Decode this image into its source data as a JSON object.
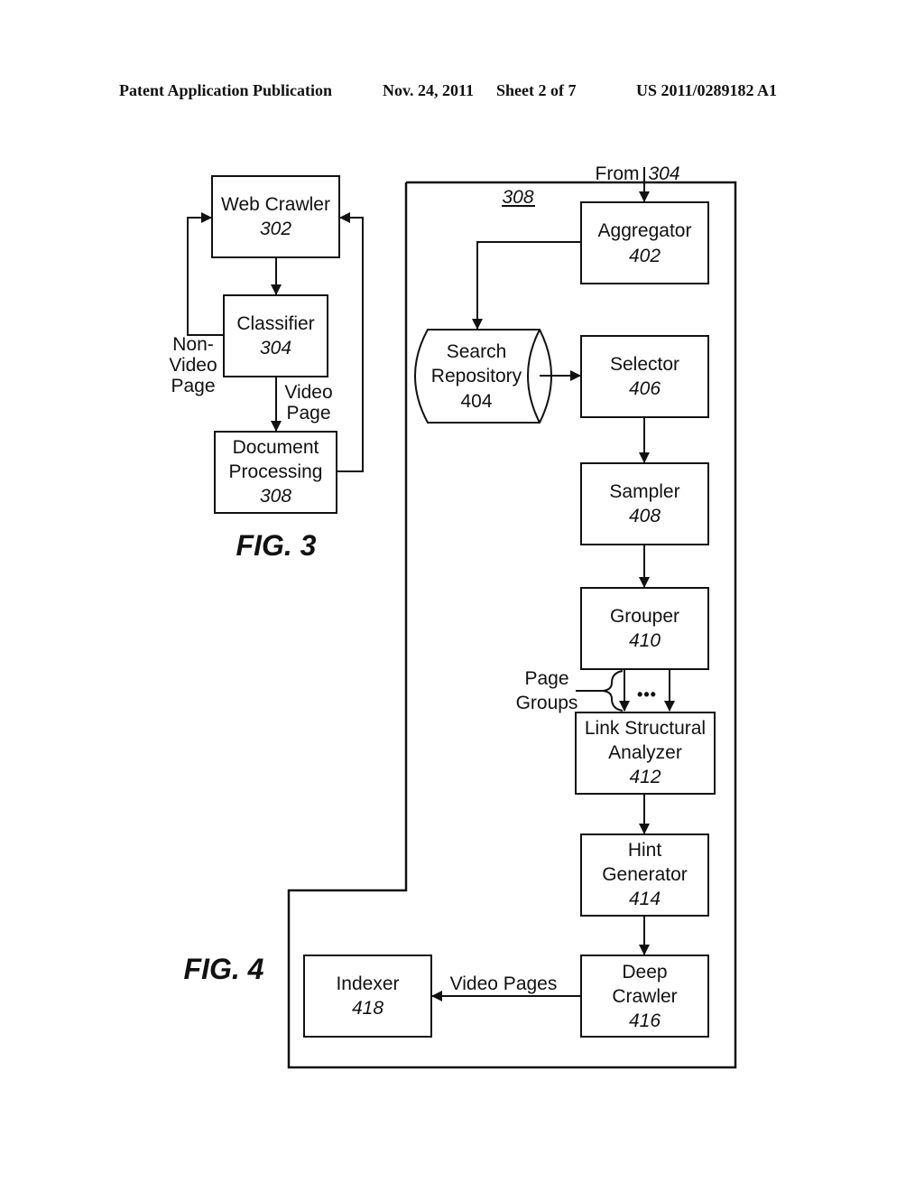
{
  "header": {
    "publication": "Patent Application Publication",
    "date": "Nov. 24, 2011",
    "sheet": "Sheet 2 of 7",
    "number": "US 2011/0289182 A1"
  },
  "fig3": {
    "caption": "FIG. 3",
    "web_crawler": {
      "label": "Web Crawler",
      "ref": "302"
    },
    "classifier": {
      "label": "Classifier",
      "ref": "304"
    },
    "document_processing": {
      "label1": "Document",
      "label2": "Processing",
      "ref": "308"
    },
    "non_video_label": [
      "Non-",
      "Video",
      "Page"
    ],
    "video_label": [
      "Video",
      "Page"
    ]
  },
  "fig4": {
    "caption": "FIG. 4",
    "container_ref": "308",
    "from_label": "From",
    "from_ref": "304",
    "aggregator": {
      "label": "Aggregator",
      "ref": "402"
    },
    "search_repository": {
      "label1": "Search",
      "label2": "Repository",
      "ref": "404"
    },
    "selector": {
      "label": "Selector",
      "ref": "406"
    },
    "sampler": {
      "label": "Sampler",
      "ref": "408"
    },
    "grouper": {
      "label": "Grouper",
      "ref": "410"
    },
    "page_groups_label": [
      "Page",
      "Groups"
    ],
    "ellipsis": "•••",
    "link_structural_analyzer": {
      "label1": "Link Structural",
      "label2": "Analyzer",
      "ref": "412"
    },
    "hint_generator": {
      "label1": "Hint",
      "label2": "Generator",
      "ref": "414"
    },
    "deep_crawler": {
      "label1": "Deep",
      "label2": "Crawler",
      "ref": "416"
    },
    "indexer": {
      "label": "Indexer",
      "ref": "418"
    },
    "video_pages_label": "Video Pages"
  }
}
